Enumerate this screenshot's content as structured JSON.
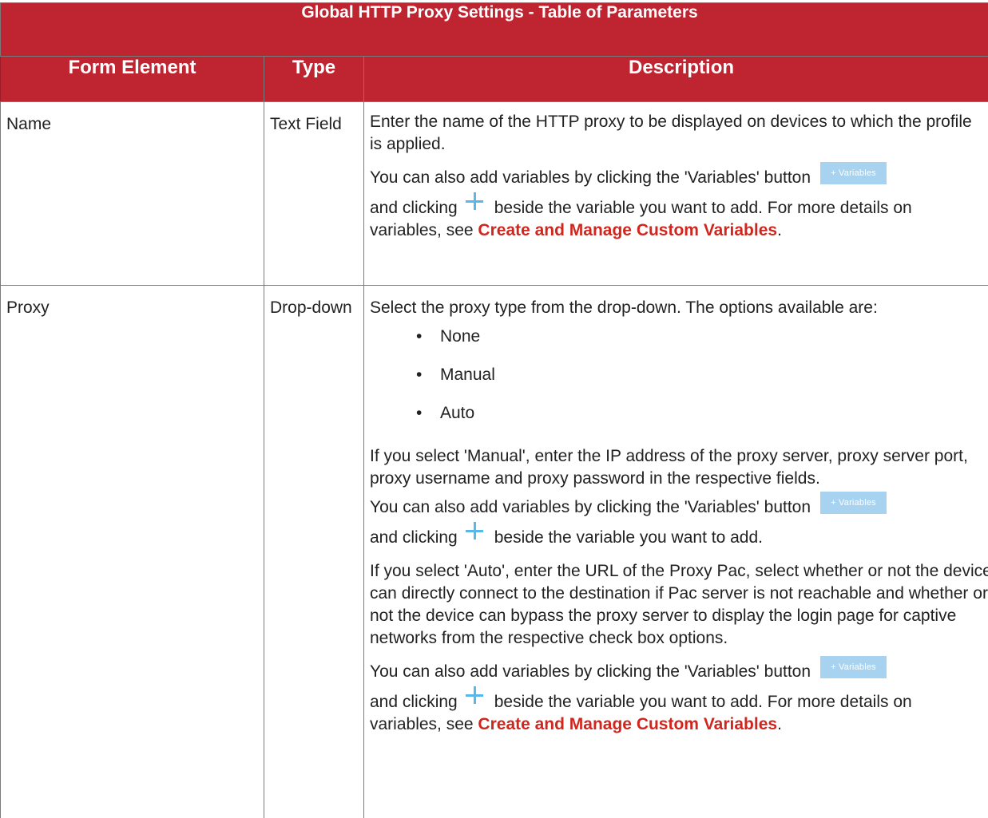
{
  "table": {
    "title": "Global HTTP Proxy Settings - Table of Parameters",
    "columns": [
      "Form Element",
      "Type",
      "Description"
    ],
    "colors": {
      "header_bg": "#bf2431",
      "link": "#d1261e",
      "variables_button": "#a8d3f0",
      "plus_icon": "#57b8ec"
    }
  },
  "rows": {
    "name": {
      "element": "Name",
      "type": "Text Field",
      "p1": "Enter the name of the HTTP proxy to be displayed on devices to which the profile is applied.",
      "p2_a": "You can also add variables by clicking the 'Variables' button",
      "button_label": "+ Variables",
      "p2_b": "and clicking",
      "p2_c": "beside the variable you want to add. For more details on",
      "p2_d": "variables, see",
      "link": "Create and Manage Custom Variables",
      "p2_end": "."
    },
    "proxy": {
      "element": "Proxy",
      "type": "Drop-down",
      "intro": "Select the proxy type from the drop-down. The options available are:",
      "bullet": "•",
      "options": [
        "None",
        "Manual",
        "Auto"
      ],
      "manual_text": "If you select 'Manual', enter the IP address of the proxy server, proxy server port, proxy username and proxy password in the respective fields.",
      "m_var_a": "You can also add variables by clicking the 'Variables' button",
      "button_label": "+ Variables",
      "m_var_b": "and clicking",
      "m_var_c": "beside the variable you want to add.",
      "auto_text": "If you select 'Auto', enter the URL of the Proxy Pac, select whether or not the device can directly connect to the destination if Pac server is not reachable and whether or not the device can bypass the proxy server to display the login page for captive networks from the respective check box options.",
      "a_var_a": "You can also add variables by clicking the 'Variables' button",
      "a_var_b": "and clicking",
      "a_var_c": "beside the variable you want to add. For more details on",
      "a_var_d": "variables, see",
      "link": "Create and Manage Custom Variables",
      "a_var_end": "."
    }
  }
}
